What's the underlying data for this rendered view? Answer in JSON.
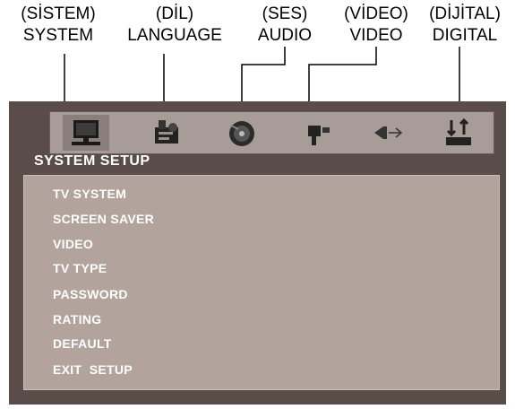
{
  "callouts": [
    {
      "turkish": "(SİSTEM)",
      "english": "SYSTEM"
    },
    {
      "turkish": "(DİL)",
      "english": "LANGUAGE"
    },
    {
      "turkish": "(SES)",
      "english": "AUDIO"
    },
    {
      "turkish": "(VİDEO)",
      "english": "VIDEO"
    },
    {
      "turkish": "(DİJİTAL)",
      "english": "DIGITAL"
    }
  ],
  "osd": {
    "tabs": [
      {
        "icon": "monitor-icon",
        "active": true
      },
      {
        "icon": "language-icon",
        "active": false
      },
      {
        "icon": "disc-icon",
        "active": false
      },
      {
        "icon": "video-camera-icon",
        "active": false
      },
      {
        "icon": "speaker-icon",
        "active": false
      },
      {
        "icon": "digital-icon",
        "active": false
      }
    ],
    "page_title": "SYSTEM SETUP",
    "menu_items": [
      "TV SYSTEM",
      "SCREEN SAVER",
      "VIDEO",
      "TV TYPE",
      "PASSWORD",
      "RATING",
      "DEFAULT",
      "EXIT  SETUP"
    ]
  },
  "colors": {
    "screen_bg": "#5a4d49",
    "icon_bar": "#a89c99",
    "menu_panel": "#b3a39d",
    "text": "#ffffff"
  }
}
